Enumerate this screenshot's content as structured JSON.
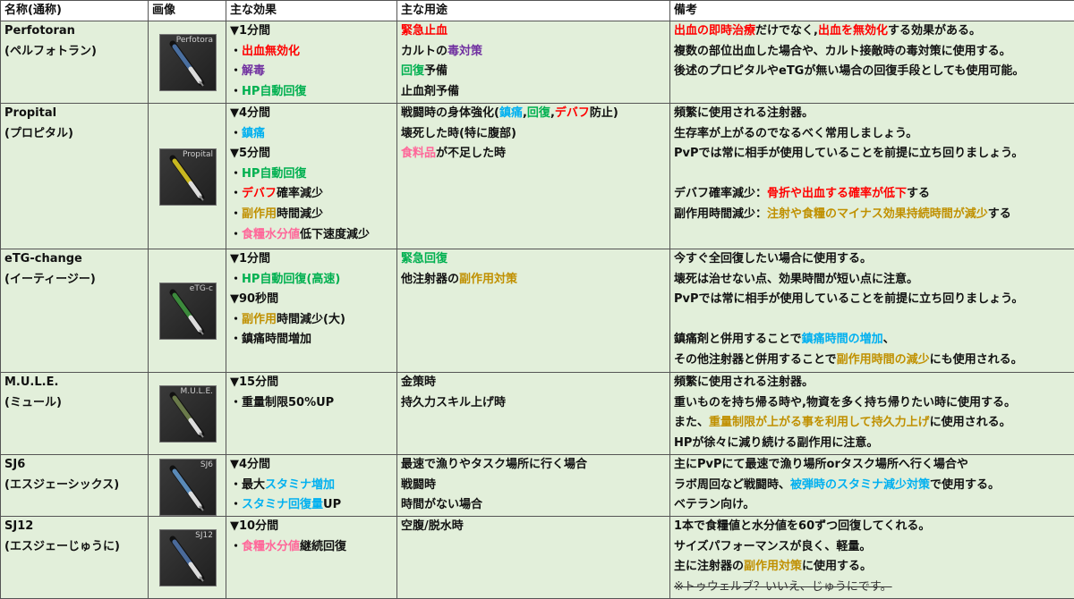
{
  "headers": {
    "name": "名称(通称)",
    "image": "画像",
    "effect": "主な効果",
    "usage": "主な用途",
    "notes": "備考"
  },
  "colors": {
    "red": "#ff0000",
    "purple": "#7030a0",
    "green": "#00b050",
    "blue": "#00b0f0",
    "gold": "#c09000",
    "pink": "#ff6699",
    "row_bg": "#e2efda"
  },
  "rows": [
    {
      "name": [
        "Perfotoran",
        "(ペルフォトラン)"
      ],
      "image_label": "Perfotora",
      "image_tint": "#4a6fa0",
      "effects": [
        [
          {
            "t": "▼1分間"
          }
        ],
        [
          {
            "t": "・"
          },
          {
            "t": "出血無効化",
            "c": "red"
          }
        ],
        [
          {
            "t": "・"
          },
          {
            "t": "解毒",
            "c": "purple"
          }
        ],
        [
          {
            "t": "・"
          },
          {
            "t": "HP自動回復",
            "c": "green"
          }
        ]
      ],
      "usage": [
        [
          {
            "t": "緊急止血",
            "c": "red"
          }
        ],
        [
          {
            "t": "カルトの"
          },
          {
            "t": "毒対策",
            "c": "purple"
          }
        ],
        [
          {
            "t": "回復",
            "c": "green"
          },
          {
            "t": "予備"
          }
        ],
        [
          {
            "t": "止血剤予備"
          }
        ]
      ],
      "notes": [
        [
          {
            "t": "出血の即時治療",
            "c": "red"
          },
          {
            "t": "だけでなく,"
          },
          {
            "t": "出血を無効化",
            "c": "red"
          },
          {
            "t": "する効果がある。"
          }
        ],
        [
          {
            "t": "複数の部位出血した場合や、カルト接敵時の毒対策に使用する。"
          }
        ],
        [
          {
            "t": "後述のプロピタルやeTGが無い場合の回復手段としても使用可能。"
          }
        ]
      ]
    },
    {
      "name": [
        "Propital",
        "(プロピタル)"
      ],
      "image_label": "Propital",
      "image_tint": "#c8b820",
      "effects": [
        [
          {
            "t": "▼4分間"
          }
        ],
        [
          {
            "t": "・"
          },
          {
            "t": "鎮痛",
            "c": "blue"
          }
        ],
        [
          {
            "t": "▼5分間"
          }
        ],
        [
          {
            "t": "・"
          },
          {
            "t": "HP自動回復",
            "c": "green"
          }
        ],
        [
          {
            "t": "・"
          },
          {
            "t": "デバフ",
            "c": "red"
          },
          {
            "t": "確率減少"
          }
        ],
        [
          {
            "t": "・"
          },
          {
            "t": "副作用",
            "c": "gold"
          },
          {
            "t": "時間減少"
          }
        ],
        [
          {
            "t": "・"
          },
          {
            "t": "食糧水分値",
            "c": "pink"
          },
          {
            "t": "低下速度減少"
          }
        ]
      ],
      "usage": [
        [
          {
            "t": "戦闘時の身体強化("
          },
          {
            "t": "鎮痛",
            "c": "blue"
          },
          {
            "t": ","
          },
          {
            "t": "回復",
            "c": "green"
          },
          {
            "t": ","
          },
          {
            "t": "デバフ",
            "c": "red"
          },
          {
            "t": "防止)"
          }
        ],
        [
          {
            "t": "壊死した時(特に腹部)"
          }
        ],
        [
          {
            "t": "食料品",
            "c": "pink"
          },
          {
            "t": "が不足した時"
          }
        ]
      ],
      "notes": [
        [
          {
            "t": "頻繁に使用される注射器。"
          }
        ],
        [
          {
            "t": "生存率が上がるのでなるべく常用しましょう。"
          }
        ],
        [
          {
            "t": "PvPでは常に相手が使用していることを前提に立ち回りましょう。"
          }
        ],
        [
          {
            "t": ""
          }
        ],
        [
          {
            "t": "デバフ確率減少："
          },
          {
            "t": "骨折や出血する確率が低下",
            "c": "red"
          },
          {
            "t": "する"
          }
        ],
        [
          {
            "t": "副作用時間減少："
          },
          {
            "t": "注射や食糧のマイナス効果持続時間が減少",
            "c": "gold"
          },
          {
            "t": "する"
          }
        ]
      ]
    },
    {
      "name": [
        "eTG-change",
        "(イーティージー)"
      ],
      "image_label": "eTG-c",
      "image_tint": "#3c8a3c",
      "effects": [
        [
          {
            "t": "▼1分間"
          }
        ],
        [
          {
            "t": "・"
          },
          {
            "t": "HP自動回復(高速)",
            "c": "green"
          }
        ],
        [
          {
            "t": "▼90秒間"
          }
        ],
        [
          {
            "t": "・"
          },
          {
            "t": "副作用",
            "c": "gold"
          },
          {
            "t": "時間減少(大)"
          }
        ],
        [
          {
            "t": "・鎮痛時間増加"
          }
        ]
      ],
      "usage": [
        [
          {
            "t": "緊急回復",
            "c": "green"
          }
        ],
        [
          {
            "t": "他注射器の"
          },
          {
            "t": "副作用対策",
            "c": "gold"
          }
        ]
      ],
      "notes": [
        [
          {
            "t": "今すぐ全回復したい場合に使用する。"
          }
        ],
        [
          {
            "t": "壊死は治せない点、効果時間が短い点に注意。"
          }
        ],
        [
          {
            "t": "PvPでは常に相手が使用していることを前提に立ち回りましょう。"
          }
        ],
        [
          {
            "t": ""
          }
        ],
        [
          {
            "t": "鎮痛剤と併用することで"
          },
          {
            "t": "鎮痛時間の増加",
            "c": "blue"
          },
          {
            "t": "、"
          }
        ],
        [
          {
            "t": "その他注射器と併用することで"
          },
          {
            "t": "副作用時間の減少",
            "c": "gold"
          },
          {
            "t": "にも使用される。"
          }
        ]
      ]
    },
    {
      "name": [
        "M.U.L.E.",
        "(ミュール)"
      ],
      "image_label": "M.U.L.E.",
      "image_tint": "#6a7a4a",
      "effects": [
        [
          {
            "t": "▼15分間"
          }
        ],
        [
          {
            "t": "・重量制限50%UP"
          }
        ]
      ],
      "usage": [
        [
          {
            "t": "金策時"
          }
        ],
        [
          {
            "t": "持久力スキル上げ時"
          }
        ]
      ],
      "notes": [
        [
          {
            "t": "頻繁に使用される注射器。"
          }
        ],
        [
          {
            "t": "重いものを持ち帰る時や,物資を多く持ち帰りたい時に使用する。"
          }
        ],
        [
          {
            "t": "また、"
          },
          {
            "t": "重量制限が上がる事を利用して持久力上げ",
            "c": "gold"
          },
          {
            "t": "に使用される。"
          }
        ],
        [
          {
            "t": "HPが徐々に減り続ける副作用に注意。"
          }
        ]
      ]
    },
    {
      "name": [
        "SJ6",
        "(エスジェーシックス)"
      ],
      "image_label": "SJ6",
      "image_tint": "#5a8ab8",
      "effects": [
        [
          {
            "t": "▼4分間"
          }
        ],
        [
          {
            "t": "・最大"
          },
          {
            "t": "スタミナ増加",
            "c": "blue"
          }
        ],
        [
          {
            "t": "・"
          },
          {
            "t": "スタミナ回復量",
            "c": "blue"
          },
          {
            "t": "UP"
          }
        ]
      ],
      "usage": [
        [
          {
            "t": "最速で漁りやタスク場所に行く場合"
          }
        ],
        [
          {
            "t": "戦闘時"
          }
        ],
        [
          {
            "t": "時間がない場合"
          }
        ]
      ],
      "notes": [
        [
          {
            "t": "主にPvPにて最速で漁り場所orタスク場所へ行く場合や"
          }
        ],
        [
          {
            "t": "ラボ周回など戦闘時、"
          },
          {
            "t": "被弾時のスタミナ減少対策",
            "c": "blue"
          },
          {
            "t": "で使用する。"
          }
        ],
        [
          {
            "t": "ベテラン向け。"
          }
        ]
      ]
    },
    {
      "name": [
        "SJ12",
        "(エスジェーじゅうに)"
      ],
      "image_label": "SJ12",
      "image_tint": "#4a6a9a",
      "effects": [
        [
          {
            "t": "▼10分間"
          }
        ],
        [
          {
            "t": "・"
          },
          {
            "t": "食糧水分値",
            "c": "pink"
          },
          {
            "t": "継続回復"
          }
        ]
      ],
      "usage": [
        [
          {
            "t": "空腹/脱水時"
          }
        ]
      ],
      "notes": [
        [
          {
            "t": "1本で食糧値と水分値を60ずつ回復してくれる。"
          }
        ],
        [
          {
            "t": "サイズパフォーマンスが良く、軽量。"
          }
        ],
        [
          {
            "t": "主に注射器の"
          },
          {
            "t": "副作用対策",
            "c": "gold"
          },
          {
            "t": "に使用する。"
          }
        ],
        [
          {
            "t": "※トゥウェルブ？いいえ、じゅうにです。",
            "s": true
          }
        ]
      ]
    }
  ]
}
